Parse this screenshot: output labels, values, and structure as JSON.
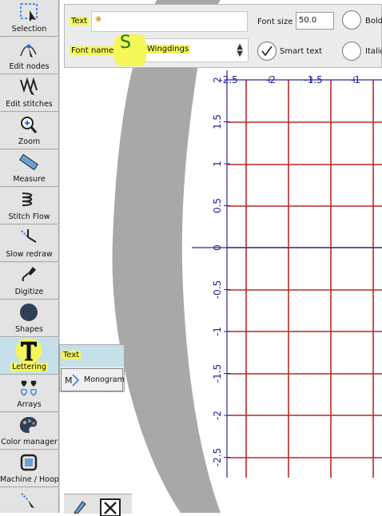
{
  "toolbar": {
    "tools": [
      {
        "label": "Selection",
        "icon": "selection-icon"
      },
      {
        "label": "Edit nodes",
        "icon": "edit-nodes-icon"
      },
      {
        "label": "Edit stitches",
        "icon": "edit-stitches-icon"
      },
      {
        "label": "Zoom",
        "icon": "zoom-icon"
      },
      {
        "label": "Measure",
        "icon": "measure-icon"
      },
      {
        "label": "Stitch Flow",
        "icon": "stitch-flow-icon"
      },
      {
        "label": "Slow redraw",
        "icon": "slow-redraw-icon"
      },
      {
        "label": "Digitize",
        "icon": "digitize-icon"
      },
      {
        "label": "Shapes",
        "icon": "shapes-icon"
      },
      {
        "label": "Lettering",
        "icon": "lettering-icon"
      },
      {
        "label": "Arrays",
        "icon": "arrays-icon"
      },
      {
        "label": "Color manager",
        "icon": "color-manager-icon"
      },
      {
        "label": "Machine / Hoop",
        "icon": "machine-hoop-icon"
      }
    ],
    "active_tool": "Lettering"
  },
  "flyout": {
    "text_label": "Text",
    "monogram_label": "Monogram"
  },
  "text_options": {
    "text_label": "Text",
    "text_value": "❀",
    "font_size_label": "Font size",
    "font_size_value": "50.0",
    "bold_label": "Bold",
    "font_name_label": "Font name",
    "font_badge": "S",
    "font_name_value": "Wingdings",
    "smart_text_label": "Smart text",
    "italic_label": "Italic"
  },
  "grid": {
    "x_ticks": [
      "-2.5",
      "-2",
      "-1.5",
      "-1"
    ],
    "y_ticks": [
      "2",
      "1.5",
      "1",
      "0.5",
      "0",
      "-0.5",
      "-1",
      "-1.5",
      "-2",
      "-2.5"
    ],
    "grid_color": "#b82a2a",
    "axis_color": "#2a2aa0"
  },
  "colors": {
    "highlight": "#f4f75a",
    "active_tool_bg": "#c6e0ea",
    "toolbar_bg": "#e3e3e3",
    "hoop_grey": "#a8a8a6"
  }
}
